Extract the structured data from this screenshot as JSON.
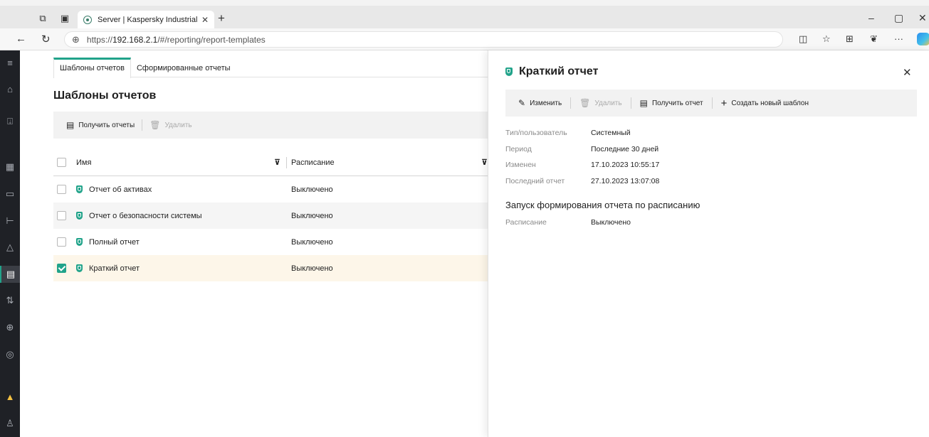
{
  "browser": {
    "tab_title": "Server | Kaspersky Industrial Cyb",
    "tab_close": "✕",
    "new_tab": "+",
    "url_prefix": "https://",
    "url_host": "192.168.2.1",
    "url_path": "/#/reporting/report-templates",
    "window_controls": [
      "–",
      "▢",
      "✕"
    ],
    "more": "···"
  },
  "sidebar": {
    "icons": [
      "menu-icon",
      "bell-icon",
      "download-icon",
      "grid-icon",
      "devices-icon",
      "tree-icon",
      "alert-icon",
      "reports-icon",
      "filters-icon",
      "globe-icon",
      "target-icon",
      "warning-icon",
      "user-icon"
    ],
    "active": "reports-icon"
  },
  "main": {
    "tabs": [
      {
        "label": "Шаблоны отчетов",
        "active": true
      },
      {
        "label": "Сформированные отчеты",
        "active": false
      }
    ],
    "title": "Шаблоны отчетов",
    "toolbar": {
      "get_reports": "Получить отчеты",
      "delete": "Удалить"
    },
    "table": {
      "columns": [
        "Имя",
        "Расписание"
      ],
      "rows": [
        {
          "name": "Отчет об активах",
          "schedule": "Выключено",
          "checked": false
        },
        {
          "name": "Отчет о безопасности системы",
          "schedule": "Выключено",
          "checked": false
        },
        {
          "name": "Полный отчет",
          "schedule": "Выключено",
          "checked": false
        },
        {
          "name": "Краткий отчет",
          "schedule": "Выключено",
          "checked": true
        }
      ]
    }
  },
  "panel": {
    "title": "Краткий отчет",
    "close": "✕",
    "toolbar": {
      "edit": "Изменить",
      "delete": "Удалить",
      "get_report": "Получить отчет",
      "create_template": "Создать новый шаблон"
    },
    "props": [
      {
        "label": "Тип/пользователь",
        "value": "Системный"
      },
      {
        "label": "Период",
        "value": "Последние 30 дней"
      },
      {
        "label": "Изменен",
        "value": "17.10.2023 10:55:17"
      },
      {
        "label": "Последний отчет",
        "value": "27.10.2023 13:07:08"
      }
    ],
    "section_title": "Запуск формирования отчета по расписанию",
    "schedule_label": "Расписание",
    "schedule_value": "Выключено"
  },
  "colors": {
    "accent": "#21a38a",
    "sidebar_bg": "#1f2126",
    "selected_row": "#fdf6e9"
  }
}
